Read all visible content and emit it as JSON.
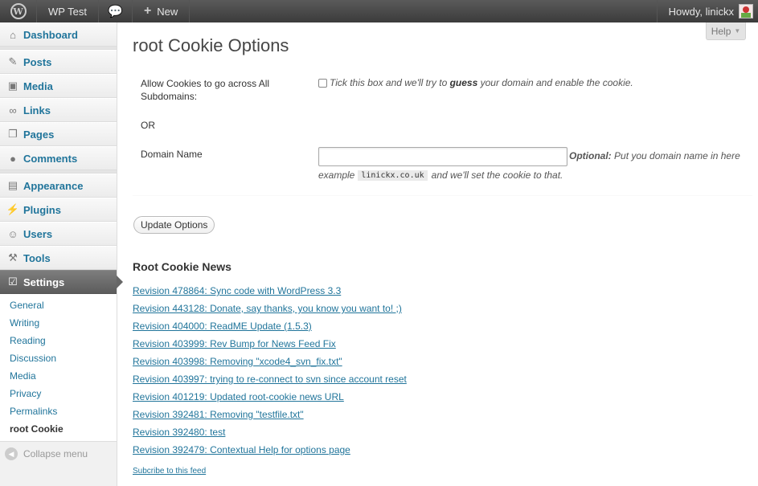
{
  "adminbar": {
    "site_name": "WP Test",
    "new_label": "New",
    "howdy": "Howdy, linickx",
    "icons": {
      "wp": "wordpress-logo-icon",
      "comments": "speech-bubble-icon",
      "new": "plus-icon"
    }
  },
  "sidebar": {
    "items": [
      {
        "label": "Dashboard",
        "icon": "home-icon"
      },
      {
        "label": "Posts",
        "icon": "pushpin-icon"
      },
      {
        "label": "Media",
        "icon": "media-icon"
      },
      {
        "label": "Links",
        "icon": "link-icon"
      },
      {
        "label": "Pages",
        "icon": "pages-icon"
      },
      {
        "label": "Comments",
        "icon": "comments-icon"
      },
      {
        "label": "Appearance",
        "icon": "appearance-icon"
      },
      {
        "label": "Plugins",
        "icon": "plugin-icon"
      },
      {
        "label": "Users",
        "icon": "users-icon"
      },
      {
        "label": "Tools",
        "icon": "tools-icon"
      },
      {
        "label": "Settings",
        "icon": "settings-icon"
      }
    ],
    "submenu": [
      "General",
      "Writing",
      "Reading",
      "Discussion",
      "Media",
      "Privacy",
      "Permalinks",
      "root Cookie"
    ],
    "collapse_label": "Collapse menu"
  },
  "help": {
    "label": "Help"
  },
  "page": {
    "title": "root Cookie Options",
    "cookie_label": "Allow Cookies to go across All Subdomains:",
    "checkbox_text_pre": "Tick this box and we'll try to",
    "checkbox_text_bold": "guess",
    "checkbox_text_post": "your domain and enable the cookie.",
    "or_label": "OR",
    "domain_label": "Domain Name",
    "domain_value": "",
    "optional_bold": "Optional:",
    "optional_text": "Put you domain name in here",
    "example_pre": "example",
    "example_code": "linickx.co.uk",
    "example_post": "and we'll set the cookie to that.",
    "update_button": "Update Options"
  },
  "news": {
    "title": "Root Cookie News",
    "items": [
      "Revision 478864: Sync code with WordPress 3.3",
      "Revision 443128: Donate, say thanks, you know you want to! ;)",
      "Revision 404000: ReadME Update (1.5.3)",
      "Revision 403999: Rev Bump for News Feed Fix",
      "Revision 403998: Removing \"xcode4_svn_fix.txt\"",
      "Revision 403997: trying to re-connect to svn since account reset",
      "Revision 401219: Updated root-cookie news URL",
      "Revision 392481: Removing \"testfile.txt\"",
      "Revision 392480: test",
      "Revision 392479: Contextual Help for options page"
    ],
    "subscribe": "Subcribe to this feed"
  }
}
